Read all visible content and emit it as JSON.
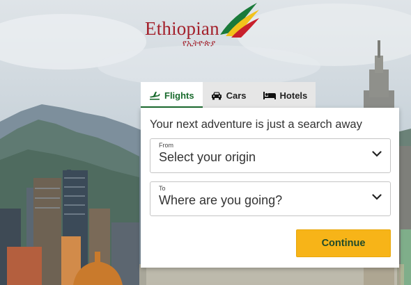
{
  "brand": {
    "name": "Ethiopian",
    "amharic": "የኢትዮጵያ",
    "colors": {
      "red": "#a3202b",
      "green": "#1a6b2e",
      "yellow": "#f7b418"
    }
  },
  "tabs": [
    {
      "label": "Flights",
      "icon": "plane-icon",
      "active": true
    },
    {
      "label": "Cars",
      "icon": "car-icon",
      "active": false
    },
    {
      "label": "Hotels",
      "icon": "bed-icon",
      "active": false
    }
  ],
  "search": {
    "headline": "Your next adventure is just a search away",
    "from": {
      "label": "From",
      "value": "Select your origin"
    },
    "to": {
      "label": "To",
      "value": "Where are you going?"
    },
    "continue_label": "Continue"
  }
}
